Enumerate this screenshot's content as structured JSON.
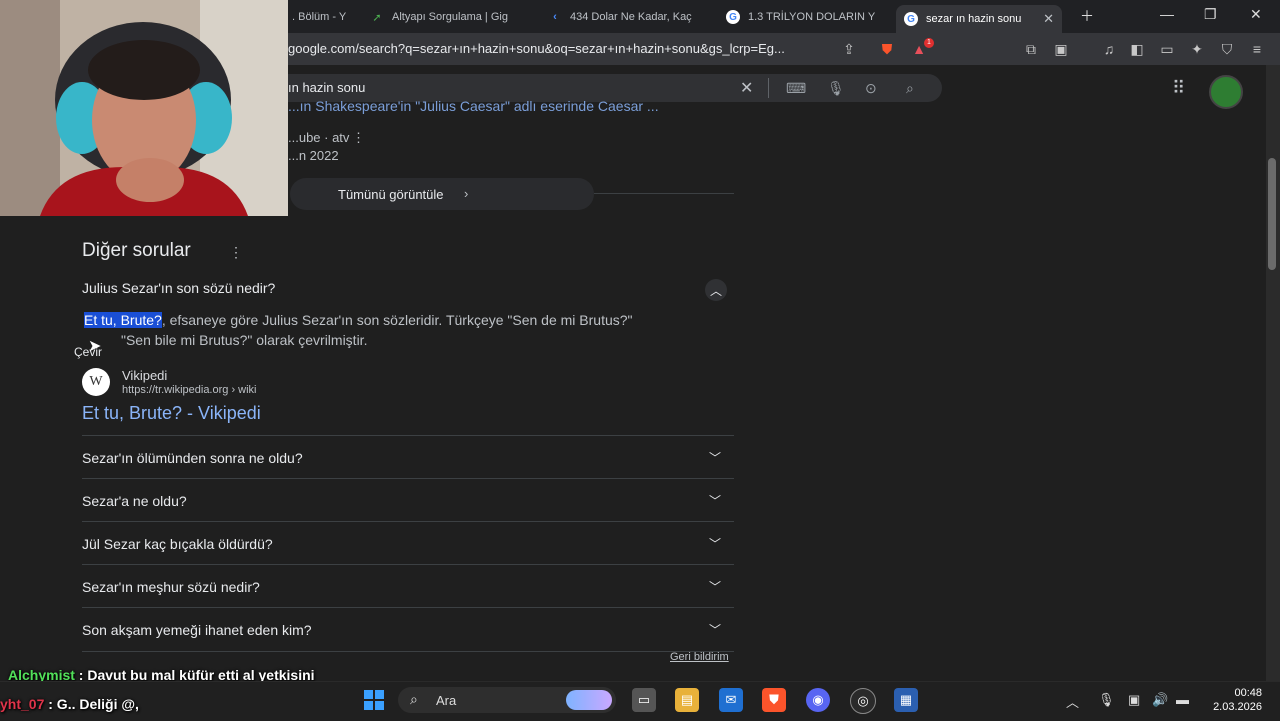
{
  "browser": {
    "tabs": [
      {
        "label": ". Bölüm - Y",
        "icon": "youtube-icon"
      },
      {
        "label": "Altyapı Sorgulama | Gig",
        "icon": "gigabit-icon"
      },
      {
        "label": "434 Dolar Ne Kadar, Kaç",
        "icon": "kolay-icon"
      },
      {
        "label": "1.3 TRİLYON DOLARIN Y",
        "icon": "google-icon"
      },
      {
        "label": "sezar ın hazin sonu",
        "icon": "google-icon"
      }
    ],
    "url": "google.com/search?q=sezar+ın+hazin+sonu&oq=sezar+ın+hazin+sonu&gs_lcrp=Eg...",
    "shield_badge": "",
    "alert_badge": "1"
  },
  "search": {
    "query": "ın hazin sonu"
  },
  "video_snippet": {
    "partial_title": "...ın Shakespeare'in \"Julius Caesar\" adlı eserinde Caesar ...",
    "meta": "...ube · atv",
    "date": "...n 2022",
    "view_all": "Tümünü görüntüle"
  },
  "paa": {
    "heading": "Diğer sorular",
    "expanded": {
      "question": "Julius Sezar'ın son sözü nedir?",
      "answer_highlight": "Et tu, Brute?",
      "answer_line1": ", efsaneye göre Julius Sezar'ın son sözleridir. Türkçeye \"Sen de mi Brutus?\"",
      "answer_line2": "\"Sen bile mi Brutus?\" olarak çevrilmiştir.",
      "tooltip": "Çevir",
      "source_name": "Vikipedi",
      "source_url": "https://tr.wikipedia.org › wiki",
      "source_title": "Et tu, Brute? - Vikipedi"
    },
    "questions": [
      "Sezar'ın ölümünden sonra ne oldu?",
      "Sezar'a ne oldu?",
      "Jül Sezar kaç bıçakla öldürdü?",
      "Sezar'ın meşhur sözü nedir?",
      "Son akşam yemeği ihanet eden kim?"
    ],
    "feedback": "Geri bildirim"
  },
  "chat": [
    {
      "user": "Alchymist",
      "message": " : Davut bu mal küfür etti al yetkisini",
      "color": "#52e05a"
    },
    {
      "user": "yht_07",
      "message": " : G.. Deliği @,",
      "color": "#e0344a"
    }
  ],
  "taskbar": {
    "search_placeholder": "Ara",
    "time": "00:48",
    "date": "2.03.2026"
  }
}
